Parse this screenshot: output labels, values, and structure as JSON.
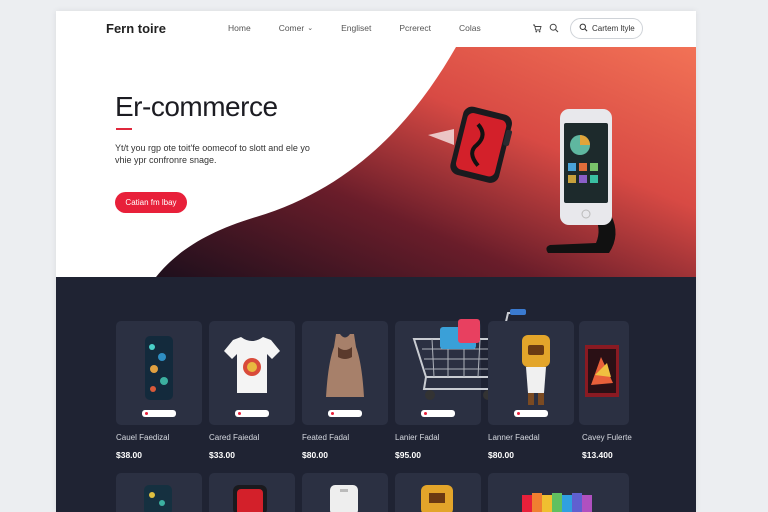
{
  "header": {
    "brand": "Fern toire",
    "nav": [
      {
        "label": "Home",
        "has_dropdown": false
      },
      {
        "label": "Comer",
        "has_dropdown": true
      },
      {
        "label": "Engliset",
        "has_dropdown": false
      },
      {
        "label": "Pcrerect",
        "has_dropdown": false
      },
      {
        "label": "Colas",
        "has_dropdown": false
      }
    ],
    "icons": [
      "cart-icon",
      "search-icon"
    ],
    "button_label": "Cartem ltyle"
  },
  "hero": {
    "title": "Er-commerce",
    "text": "Yt/t you rgp ote toit'fe oomecof to slott and ele yo vhie ypr confronre snage.",
    "cta_label": "Catian fm lbay"
  },
  "products": {
    "row1": [
      {
        "name": "Cauel Faedizal",
        "price": "$38.00",
        "image": "phone-case"
      },
      {
        "name": "Cared Faiedal",
        "price": "$33.00",
        "image": "t-shirt"
      },
      {
        "name": "Feated Fadal",
        "price": "$80.00",
        "image": "tank-dress"
      },
      {
        "name": "Lanier Fadal",
        "price": "$95.00",
        "image": "shopping-cart"
      },
      {
        "name": "Lanner Faedal",
        "price": "$80.00",
        "image": "figurine"
      },
      {
        "name": "Cavey Fulerte",
        "price": "$13.400",
        "image": "game-box"
      }
    ]
  },
  "colors": {
    "accent": "#e8203a",
    "hero_gradient_start": "#2a1220",
    "hero_gradient_end": "#f06a52",
    "section_bg": "#1f2333",
    "card_bg": "#2b3042"
  }
}
